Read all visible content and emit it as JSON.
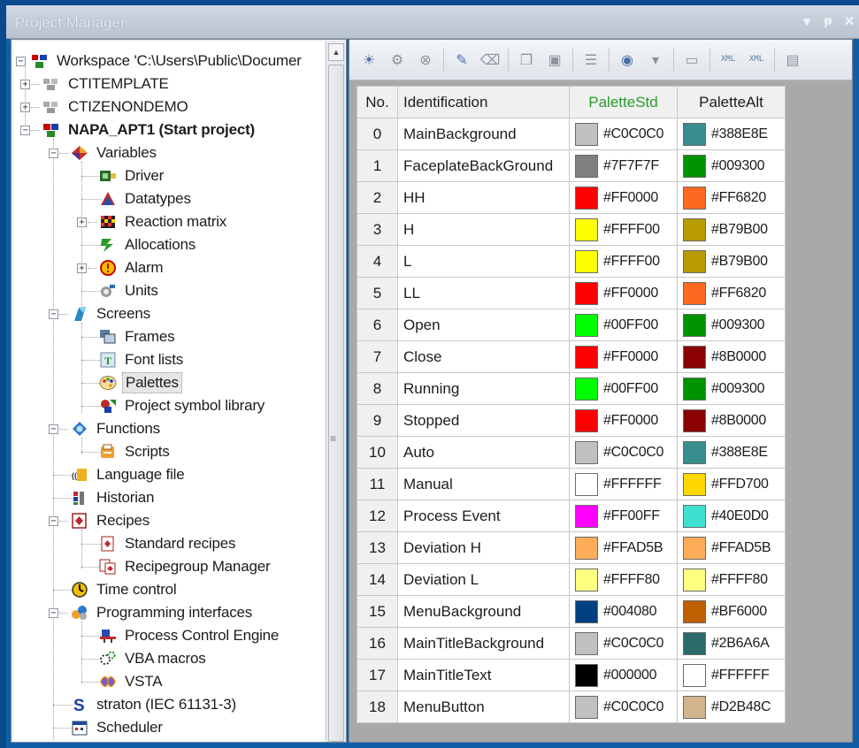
{
  "window": {
    "title": "Project Manager",
    "controls": [
      "▾",
      "ᵽ",
      "✕"
    ]
  },
  "tree": {
    "workspace": "Workspace 'C:\\Users\\Public\\Documer",
    "items": [
      {
        "label": "CTITEMPLATE"
      },
      {
        "label": "CTIZENONDEMO"
      },
      {
        "label": "NAPA_APT1 (Start project)"
      },
      {
        "label": "Variables"
      },
      {
        "label": "Driver"
      },
      {
        "label": "Datatypes"
      },
      {
        "label": "Reaction matrix"
      },
      {
        "label": "Allocations"
      },
      {
        "label": "Alarm"
      },
      {
        "label": "Units"
      },
      {
        "label": "Screens"
      },
      {
        "label": "Frames"
      },
      {
        "label": "Font lists"
      },
      {
        "label": "Palettes"
      },
      {
        "label": "Project symbol library"
      },
      {
        "label": "Functions"
      },
      {
        "label": "Scripts"
      },
      {
        "label": "Language file"
      },
      {
        "label": "Historian"
      },
      {
        "label": "Recipes"
      },
      {
        "label": "Standard recipes"
      },
      {
        "label": "Recipegroup Manager"
      },
      {
        "label": "Time control"
      },
      {
        "label": "Programming interfaces"
      },
      {
        "label": "Process Control Engine"
      },
      {
        "label": "VBA macros"
      },
      {
        "label": "VSTA"
      },
      {
        "label": "straton (IEC 61131-3)"
      },
      {
        "label": "Scheduler"
      }
    ]
  },
  "toolbar": {
    "icons": [
      "palette-new-icon",
      "palette-gear-icon",
      "palette-delete-icon",
      "wand-icon",
      "eraser-icon",
      "copy-icon",
      "paste-icon",
      "rename-icon",
      "color-picker-icon",
      "dropdown-arrow-icon",
      "save-icon",
      "xml-export-icon",
      "xml-import-icon",
      "properties-icon"
    ],
    "xml_label": "XML"
  },
  "table": {
    "headers": {
      "no": "No.",
      "id": "Identification",
      "std": "PaletteStd",
      "alt": "PaletteAlt"
    },
    "rows": [
      {
        "no": "0",
        "id": "MainBackground",
        "std": "#C0C0C0",
        "alt": "#388E8E"
      },
      {
        "no": "1",
        "id": "FaceplateBackGround",
        "std": "#7F7F7F",
        "alt": "#009300"
      },
      {
        "no": "2",
        "id": "HH",
        "std": "#FF0000",
        "alt": "#FF6820"
      },
      {
        "no": "3",
        "id": "H",
        "std": "#FFFF00",
        "alt": "#B79B00"
      },
      {
        "no": "4",
        "id": "L",
        "std": "#FFFF00",
        "alt": "#B79B00"
      },
      {
        "no": "5",
        "id": "LL",
        "std": "#FF0000",
        "alt": "#FF6820"
      },
      {
        "no": "6",
        "id": "Open",
        "std": "#00FF00",
        "alt": "#009300"
      },
      {
        "no": "7",
        "id": "Close",
        "std": "#FF0000",
        "alt": "#8B0000"
      },
      {
        "no": "8",
        "id": "Running",
        "std": "#00FF00",
        "alt": "#009300"
      },
      {
        "no": "9",
        "id": "Stopped",
        "std": "#FF0000",
        "alt": "#8B0000"
      },
      {
        "no": "10",
        "id": "Auto",
        "std": "#C0C0C0",
        "alt": "#388E8E"
      },
      {
        "no": "11",
        "id": "Manual",
        "std": "#FFFFFF",
        "alt": "#FFD700"
      },
      {
        "no": "12",
        "id": "Process Event",
        "std": "#FF00FF",
        "alt": "#40E0D0"
      },
      {
        "no": "13",
        "id": "Deviation H",
        "std": "#FFAD5B",
        "alt": "#FFAD5B"
      },
      {
        "no": "14",
        "id": "Deviation L",
        "std": "#FFFF80",
        "alt": "#FFFF80"
      },
      {
        "no": "15",
        "id": "MenuBackground",
        "std": "#004080",
        "alt": "#BF6000"
      },
      {
        "no": "16",
        "id": "MainTitleBackground",
        "std": "#C0C0C0",
        "alt": "#2B6A6A"
      },
      {
        "no": "17",
        "id": "MainTitleText",
        "std": "#000000",
        "alt": "#FFFFFF"
      },
      {
        "no": "18",
        "id": "MenuButton",
        "std": "#C0C0C0",
        "alt": "#D2B48C"
      }
    ]
  }
}
